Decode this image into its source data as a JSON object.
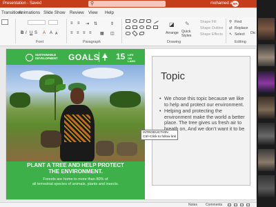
{
  "titlebar": {
    "document": "Presentation - Saved",
    "search_icon": "search-icon",
    "user_name": "mohamed ali",
    "user_initials": "MA"
  },
  "menu": {
    "tabs": [
      "Transitions",
      "Animations",
      "Slide Show",
      "Review",
      "View",
      "Help"
    ]
  },
  "ribbon": {
    "groups": [
      "Font",
      "Paragraph",
      "Drawing",
      "Editing"
    ],
    "arrange": "Arrange",
    "quick_styles": "Quick Styles",
    "shape_fill": "Shape Fill",
    "shape_outline": "Shape Outline",
    "shape_effects": "Shape Effects",
    "find": "Find",
    "replace": "Replace",
    "select": "Select",
    "dictate": "Dic"
  },
  "slide": {
    "sdg_header": {
      "sustainable": "SUSTAINABLE",
      "development": "DEVELOPMENT",
      "goals": "GOALS",
      "number": "15",
      "life": "LIFE",
      "on_land": "ON LAND"
    },
    "caption_heading_1": "PLANT A TREE AND HELP PROTECT",
    "caption_heading_2": "THE ENVIRONMENT.",
    "caption_body_1": "Forests are home to more than 80% of",
    "caption_body_2": "all terrestrial species of animals, plants and insects.",
    "topic_title": "Topic",
    "bullets": [
      "We chose this topic because we like to help and protect our environment.",
      "Helping and protecting the environment make the world a better place. The tree gives us fresh air to breath on, And we don’t want it to be rem."
    ],
    "tooltip_line1": "INTRODUCTION",
    "tooltip_line2": "Ctrl+Click to follow link"
  },
  "statusbar": {
    "notes": "Notes",
    "comments": "Comments"
  },
  "colors": {
    "brand": "#c43e1c",
    "sdg_green": "#3eb049"
  }
}
